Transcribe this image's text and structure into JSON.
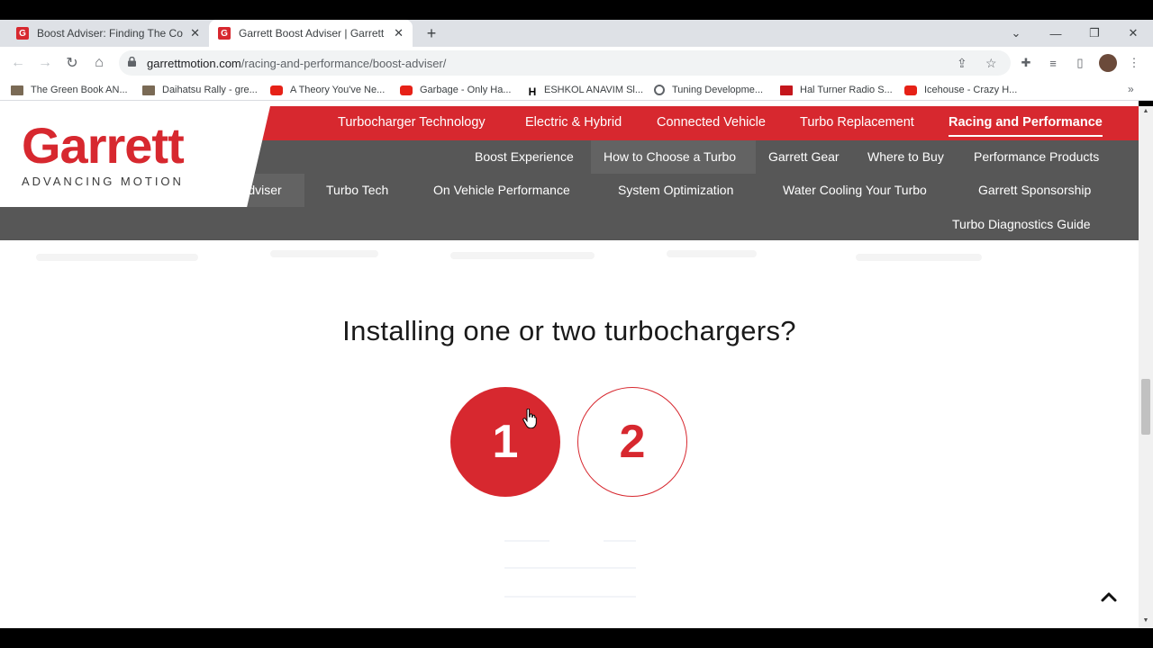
{
  "browser": {
    "tabs": [
      {
        "title": "Boost Adviser: Finding The Corre",
        "active": false
      },
      {
        "title": "Garrett Boost Adviser | Garrett Tu",
        "active": true
      }
    ],
    "url_host": "garrettmotion.com",
    "url_path": "/racing-and-performance/boost-adviser/",
    "bookmarks": [
      {
        "label": "The Green Book AN...",
        "icon": "image-icon"
      },
      {
        "label": "Daihatsu Rally - gre...",
        "icon": "image-icon"
      },
      {
        "label": "A Theory You've Ne...",
        "icon": "youtube-icon"
      },
      {
        "label": "Garbage - Only Ha...",
        "icon": "youtube-icon"
      },
      {
        "label": "ESHKOL ANAVIM Sl...",
        "icon": "h-icon"
      },
      {
        "label": "Tuning Developme...",
        "icon": "globe-icon"
      },
      {
        "label": "Hal Turner Radio S...",
        "icon": "hal-icon"
      },
      {
        "label": "Icehouse - Crazy H...",
        "icon": "youtube-icon"
      }
    ]
  },
  "site": {
    "logo_word": "Garrett",
    "logo_tagline": "ADVANCING MOTION",
    "primary_nav": [
      "Turbocharger Technology",
      "Electric & Hybrid",
      "Connected Vehicle",
      "Turbo Replacement",
      "Racing and Performance"
    ],
    "secondary_nav": [
      "Boost Experience",
      "How to Choose a Turbo",
      "Garrett Gear",
      "Where to Buy",
      "Performance Products"
    ],
    "tertiary_nav": [
      "Adviser",
      "Turbo Tech",
      "On Vehicle Performance",
      "System Optimization",
      "Water Cooling Your Turbo",
      "Garrett Sponsorship",
      "Turbo Diagnostics Guide"
    ],
    "question": "Installing one or two turbochargers?",
    "choices": [
      "1",
      "2"
    ],
    "selected_choice": "1",
    "brand_color": "#d7282f"
  }
}
